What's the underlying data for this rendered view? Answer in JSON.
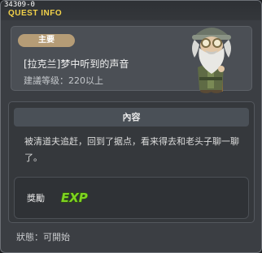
{
  "window": {
    "quest_code": "34309-0",
    "title": "QUEST INFO"
  },
  "quest": {
    "category_badge": "主要",
    "name": "[拉克兰]梦中听到的声音",
    "level_requirement": "建議等级：220以上"
  },
  "content": {
    "header": "內容",
    "description": "被清道夫追赶，回到了据点，看来得去和老头子聊一聊了。"
  },
  "reward": {
    "label": "獎勵",
    "icon": "exp-icon",
    "icon_text": "EXP"
  },
  "status": {
    "text": "狀態：可開始"
  },
  "colors": {
    "title_accent": "#f3d24a",
    "badge": "#b59c76",
    "exp_green": "#7ed321"
  }
}
